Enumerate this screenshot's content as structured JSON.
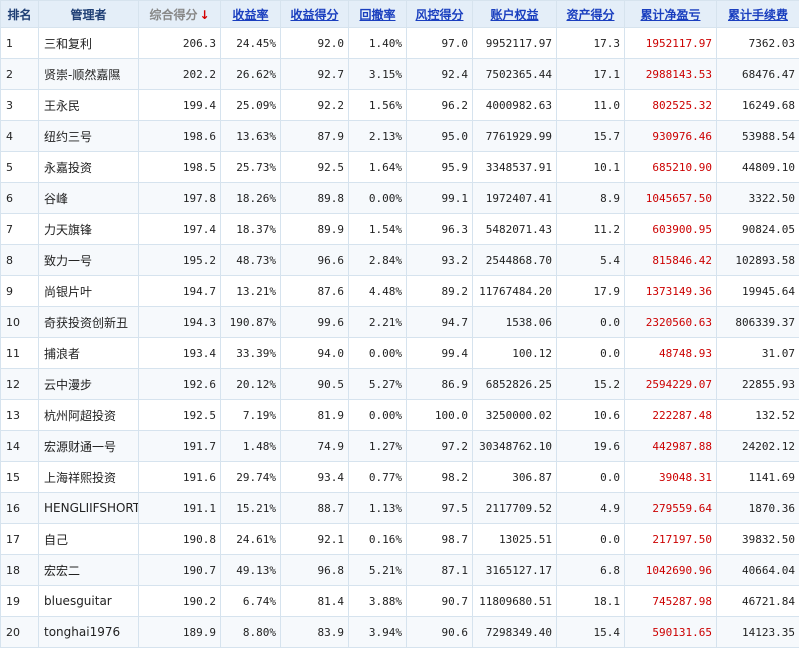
{
  "headers": {
    "rank": "排名",
    "manager": "管理者",
    "total_score": "综合得分",
    "sort_arrow": "↓",
    "return_rate": "收益率",
    "return_score": "收益得分",
    "drawdown": "回撤率",
    "risk_score": "风控得分",
    "equity": "账户权益",
    "asset_score": "资产得分",
    "net_profit": "累计净盈亏",
    "fees": "累计手续费"
  },
  "colors": {
    "header_bg": "#e4eef8",
    "link": "#1a3fbf",
    "profit": "#cc0000",
    "border": "#d6e3ee"
  },
  "rows": [
    {
      "rank": "1",
      "manager": "三和复利",
      "total": "206.3",
      "return_rate": "24.45%",
      "return_score": "92.0",
      "drawdown": "1.40%",
      "risk": "97.0",
      "equity": "9952117.97",
      "asset": "17.3",
      "profit": "1952117.97",
      "fees": "7362.03"
    },
    {
      "rank": "2",
      "manager": "贤崇-顺然嘉隰",
      "total": "202.2",
      "return_rate": "26.62%",
      "return_score": "92.7",
      "drawdown": "3.15%",
      "risk": "92.4",
      "equity": "7502365.44",
      "asset": "17.1",
      "profit": "2988143.53",
      "fees": "68476.47"
    },
    {
      "rank": "3",
      "manager": "王永民",
      "total": "199.4",
      "return_rate": "25.09%",
      "return_score": "92.2",
      "drawdown": "1.56%",
      "risk": "96.2",
      "equity": "4000982.63",
      "asset": "11.0",
      "profit": "802525.32",
      "fees": "16249.68"
    },
    {
      "rank": "4",
      "manager": "纽约三号",
      "total": "198.6",
      "return_rate": "13.63%",
      "return_score": "87.9",
      "drawdown": "2.13%",
      "risk": "95.0",
      "equity": "7761929.99",
      "asset": "15.7",
      "profit": "930976.46",
      "fees": "53988.54"
    },
    {
      "rank": "5",
      "manager": "永嘉投资",
      "total": "198.5",
      "return_rate": "25.73%",
      "return_score": "92.5",
      "drawdown": "1.64%",
      "risk": "95.9",
      "equity": "3348537.91",
      "asset": "10.1",
      "profit": "685210.90",
      "fees": "44809.10"
    },
    {
      "rank": "6",
      "manager": "谷峰",
      "total": "197.8",
      "return_rate": "18.26%",
      "return_score": "89.8",
      "drawdown": "0.00%",
      "risk": "99.1",
      "equity": "1972407.41",
      "asset": "8.9",
      "profit": "1045657.50",
      "fees": "3322.50"
    },
    {
      "rank": "7",
      "manager": "力天旗锋",
      "total": "197.4",
      "return_rate": "18.37%",
      "return_score": "89.9",
      "drawdown": "1.54%",
      "risk": "96.3",
      "equity": "5482071.43",
      "asset": "11.2",
      "profit": "603900.95",
      "fees": "90824.05"
    },
    {
      "rank": "8",
      "manager": "致力一号",
      "total": "195.2",
      "return_rate": "48.73%",
      "return_score": "96.6",
      "drawdown": "2.84%",
      "risk": "93.2",
      "equity": "2544868.70",
      "asset": "5.4",
      "profit": "815846.42",
      "fees": "102893.58"
    },
    {
      "rank": "9",
      "manager": "尚银片叶",
      "total": "194.7",
      "return_rate": "13.21%",
      "return_score": "87.6",
      "drawdown": "4.48%",
      "risk": "89.2",
      "equity": "11767484.20",
      "asset": "17.9",
      "profit": "1373149.36",
      "fees": "19945.64"
    },
    {
      "rank": "10",
      "manager": "奇获投资创新丑",
      "total": "194.3",
      "return_rate": "190.87%",
      "return_score": "99.6",
      "drawdown": "2.21%",
      "risk": "94.7",
      "equity": "1538.06",
      "asset": "0.0",
      "profit": "2320560.63",
      "fees": "806339.37"
    },
    {
      "rank": "11",
      "manager": "捕浪者",
      "total": "193.4",
      "return_rate": "33.39%",
      "return_score": "94.0",
      "drawdown": "0.00%",
      "risk": "99.4",
      "equity": "100.12",
      "asset": "0.0",
      "profit": "48748.93",
      "fees": "31.07"
    },
    {
      "rank": "12",
      "manager": "云中漫步",
      "total": "192.6",
      "return_rate": "20.12%",
      "return_score": "90.5",
      "drawdown": "5.27%",
      "risk": "86.9",
      "equity": "6852826.25",
      "asset": "15.2",
      "profit": "2594229.07",
      "fees": "22855.93"
    },
    {
      "rank": "13",
      "manager": "杭州阿超投资",
      "total": "192.5",
      "return_rate": "7.19%",
      "return_score": "81.9",
      "drawdown": "0.00%",
      "risk": "100.0",
      "equity": "3250000.02",
      "asset": "10.6",
      "profit": "222287.48",
      "fees": "132.52"
    },
    {
      "rank": "14",
      "manager": "宏源财通一号",
      "total": "191.7",
      "return_rate": "1.48%",
      "return_score": "74.9",
      "drawdown": "1.27%",
      "risk": "97.2",
      "equity": "30348762.10",
      "asset": "19.6",
      "profit": "442987.88",
      "fees": "24202.12"
    },
    {
      "rank": "15",
      "manager": "上海祥熙投资",
      "total": "191.6",
      "return_rate": "29.74%",
      "return_score": "93.4",
      "drawdown": "0.77%",
      "risk": "98.2",
      "equity": "306.87",
      "asset": "0.0",
      "profit": "39048.31",
      "fees": "1141.69"
    },
    {
      "rank": "16",
      "manager": "HENGLIIFSHORT",
      "total": "191.1",
      "return_rate": "15.21%",
      "return_score": "88.7",
      "drawdown": "1.13%",
      "risk": "97.5",
      "equity": "2117709.52",
      "asset": "4.9",
      "profit": "279559.64",
      "fees": "1870.36"
    },
    {
      "rank": "17",
      "manager": "自己",
      "total": "190.8",
      "return_rate": "24.61%",
      "return_score": "92.1",
      "drawdown": "0.16%",
      "risk": "98.7",
      "equity": "13025.51",
      "asset": "0.0",
      "profit": "217197.50",
      "fees": "39832.50"
    },
    {
      "rank": "18",
      "manager": "宏宏二",
      "total": "190.7",
      "return_rate": "49.13%",
      "return_score": "96.8",
      "drawdown": "5.21%",
      "risk": "87.1",
      "equity": "3165127.17",
      "asset": "6.8",
      "profit": "1042690.96",
      "fees": "40664.04"
    },
    {
      "rank": "19",
      "manager": "bluesguitar",
      "total": "190.2",
      "return_rate": "6.74%",
      "return_score": "81.4",
      "drawdown": "3.88%",
      "risk": "90.7",
      "equity": "11809680.51",
      "asset": "18.1",
      "profit": "745287.98",
      "fees": "46721.84"
    },
    {
      "rank": "20",
      "manager": "tonghai1976",
      "total": "189.9",
      "return_rate": "8.80%",
      "return_score": "83.9",
      "drawdown": "3.94%",
      "risk": "90.6",
      "equity": "7298349.40",
      "asset": "15.4",
      "profit": "590131.65",
      "fees": "14123.35"
    }
  ]
}
